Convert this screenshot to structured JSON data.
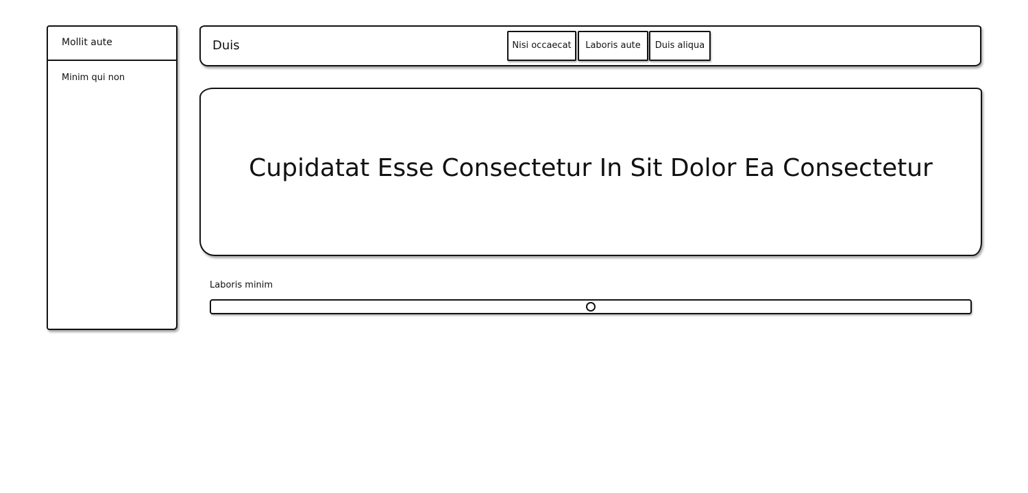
{
  "sidebar": {
    "items": [
      {
        "label": "Mollit aute"
      },
      {
        "label": "Minim qui non"
      }
    ]
  },
  "header": {
    "title": "Duis",
    "tabs": [
      {
        "label": "Nisi occaecat"
      },
      {
        "label": "Laboris aute"
      },
      {
        "label": "Duis aliqua"
      }
    ]
  },
  "hero": {
    "heading": "Cupidatat Esse Consectetur In Sit Dolor Ea Consectetur"
  },
  "slider": {
    "label": "Laboris minim",
    "value_fraction": 0.5
  }
}
